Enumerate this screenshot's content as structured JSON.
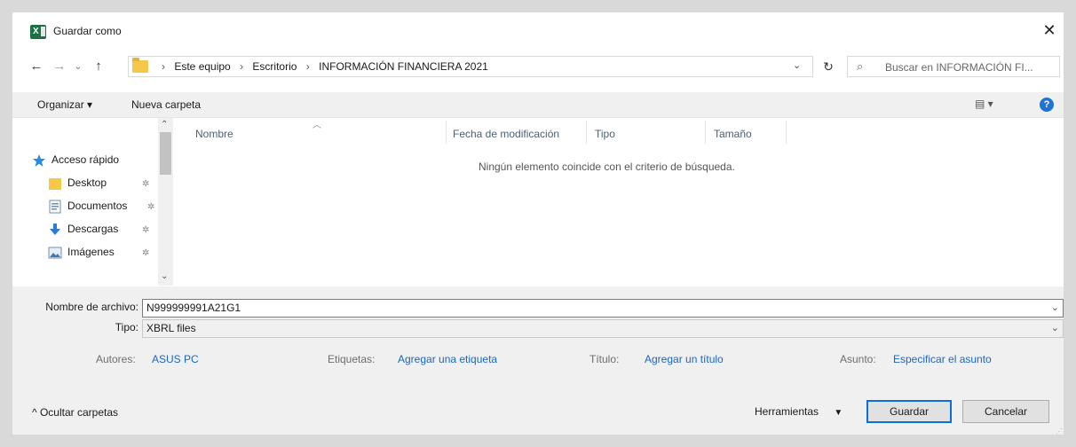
{
  "window": {
    "title": "Guardar como",
    "close_glyph": "✕",
    "app_icon": "excel-icon"
  },
  "nav": {
    "back_glyph": "←",
    "forward_glyph": "→",
    "recent_glyph": "⌄",
    "up_glyph": "↑",
    "breadcrumbs": [
      "Este equipo",
      "Escritorio",
      "INFORMACIÓN FINANCIERA 2021"
    ],
    "separator": "›",
    "refresh_glyph": "↻",
    "search_placeholder": "Buscar en INFORMACIÓN FI..."
  },
  "toolbar": {
    "organize_label": "Organizar ▾",
    "new_folder_label": "Nueva carpeta",
    "view_glyph": "▤ ▾",
    "help_glyph": "?"
  },
  "sidebar": {
    "items": [
      {
        "label": "Acceso rápido",
        "icon": "star-icon",
        "pinned": false
      },
      {
        "label": "Desktop",
        "icon": "folder-icon",
        "pinned": true
      },
      {
        "label": "Documentos",
        "icon": "documents-icon",
        "pinned": true
      },
      {
        "label": "Descargas",
        "icon": "download-icon",
        "pinned": true
      },
      {
        "label": "Imágenes",
        "icon": "pictures-icon",
        "pinned": true
      }
    ],
    "pin_glyph": "✲"
  },
  "filelist": {
    "columns": [
      "Nombre",
      "Fecha de modificación",
      "Tipo",
      "Tamaño"
    ],
    "empty_message": "Ningún elemento coincide con el criterio de búsqueda."
  },
  "save": {
    "filename_label": "Nombre de archivo:",
    "filename_value": "N999999991A21G1",
    "type_label": "Tipo:",
    "type_value": "XBRL files",
    "meta": [
      {
        "label": "Autores:",
        "value": "ASUS PC"
      },
      {
        "label": "Etiquetas:",
        "value": "Agregar una etiqueta"
      },
      {
        "label": "Título:",
        "value": "Agregar un título"
      },
      {
        "label": "Asunto:",
        "value": "Especificar el asunto"
      }
    ],
    "hide_folders_label": "^  Ocultar carpetas",
    "tools_label": "Herramientas",
    "save_button": "Guardar",
    "cancel_button": "Cancelar"
  },
  "colors": {
    "accent": "#0a6fd8",
    "link": "#1a67c0",
    "excel_green": "#1d7044",
    "help_blue": "#1e73d4"
  }
}
